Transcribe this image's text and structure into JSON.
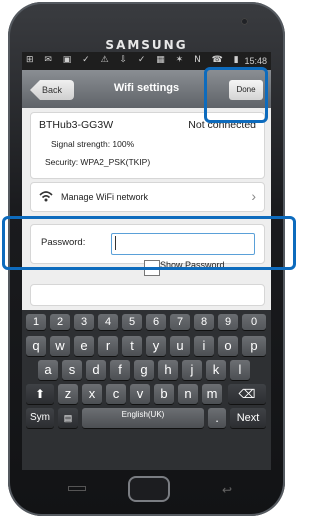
{
  "device": {
    "brand": "SAMSUNG"
  },
  "statusbar": {
    "icons": "⊞ ✉ ▣ ✓ ⚠ ⇩ ✓ ▦ ✶ N ☎ ▮",
    "time": "15:48"
  },
  "titlebar": {
    "back_label": "Back",
    "title": "Wifi settings",
    "done_label": "Done"
  },
  "network": {
    "name": "BTHub3-GG3W",
    "status": "Not connected",
    "strength": "Signal strength:  100%",
    "security": "Security:  WPA2_PSK(TKIP)"
  },
  "manage": {
    "label": "Manage WiFi network",
    "chevron": "›"
  },
  "password": {
    "label": "Password:",
    "value": "",
    "placeholder": ""
  },
  "show_password": {
    "label": "Show Password"
  },
  "keyboard": {
    "row_numbers": [
      "1",
      "2",
      "3",
      "4",
      "5",
      "6",
      "7",
      "8",
      "9",
      "0"
    ],
    "row1": [
      "q",
      "w",
      "e",
      "r",
      "t",
      "y",
      "u",
      "i",
      "o",
      "p"
    ],
    "row2": [
      "a",
      "s",
      "d",
      "f",
      "g",
      "h",
      "j",
      "k",
      "l"
    ],
    "row3": [
      "z",
      "x",
      "c",
      "v",
      "b",
      "n",
      "m"
    ],
    "shift": "⬆",
    "delete": "⌫",
    "sym": "Sym",
    "space": "English(UK)",
    "period": ".",
    "next": "Next"
  },
  "highlight_color": "#0d6bbd"
}
